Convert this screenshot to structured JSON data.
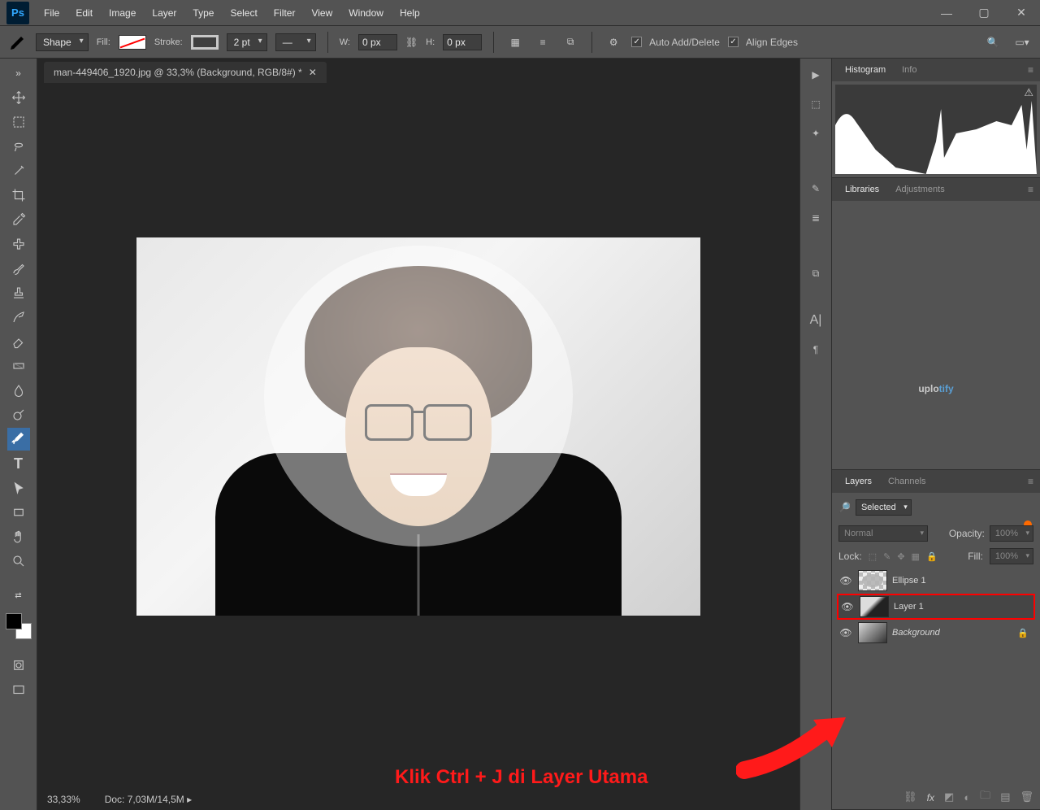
{
  "app": {
    "logo": "Ps"
  },
  "menu": [
    "File",
    "Edit",
    "Image",
    "Layer",
    "Type",
    "Select",
    "Filter",
    "View",
    "Window",
    "Help"
  ],
  "options": {
    "mode": "Shape",
    "fill_label": "Fill:",
    "stroke_label": "Stroke:",
    "stroke_width": "2 pt",
    "w_label": "W:",
    "w_val": "0 px",
    "h_label": "H:",
    "h_val": "0 px",
    "auto_add": "Auto Add/Delete",
    "align_edges": "Align Edges"
  },
  "document": {
    "tab_title": "man-449406_1920.jpg @ 33,3% (Background, RGB/8#) *",
    "zoom": "33,33%",
    "doc_info": "Doc: 7,03M/14,5M"
  },
  "panels": {
    "histogram": {
      "tabs": [
        "Histogram",
        "Info"
      ]
    },
    "libraries": {
      "tabs": [
        "Libraries",
        "Adjustments"
      ],
      "watermark_a": "uplo",
      "watermark_b": "tify"
    },
    "layers": {
      "tabs": [
        "Layers",
        "Channels"
      ],
      "filter": "Selected",
      "blend": "Normal",
      "opacity_label": "Opacity:",
      "opacity_val": "100%",
      "lock_label": "Lock:",
      "fill_label": "Fill:",
      "fill_val": "100%",
      "items": [
        {
          "name": "Ellipse 1",
          "thumb": "checker",
          "locked": false,
          "selected": false,
          "italic": false
        },
        {
          "name": "Layer 1",
          "thumb": "photo",
          "locked": false,
          "selected": true,
          "italic": false
        },
        {
          "name": "Background",
          "thumb": "photo",
          "locked": true,
          "selected": false,
          "italic": true
        }
      ]
    }
  },
  "annotation": "Klik Ctrl + J di Layer Utama"
}
